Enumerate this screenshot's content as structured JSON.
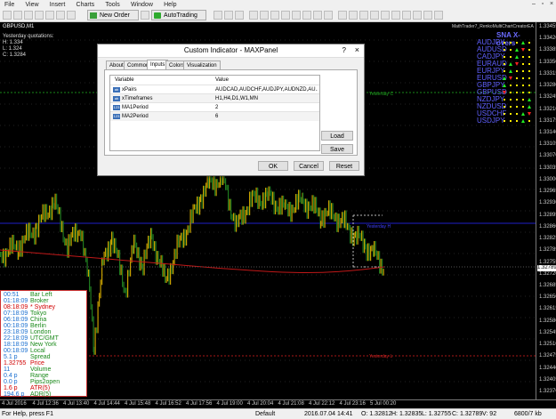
{
  "menu": [
    "File",
    "View",
    "Insert",
    "Charts",
    "Tools",
    "Window",
    "Help"
  ],
  "window_controls": [
    "–",
    "▫",
    "×"
  ],
  "toolbar": {
    "new_order": "New Order",
    "autotrading": "AutoTrading"
  },
  "chart": {
    "tab_title": "GBPUSD,M1",
    "info_lines": [
      "Yesterday quotations:",
      "H: 1.334",
      "L: 1.324",
      "C: 1.3284"
    ],
    "price_labels": [
      "1.33455",
      "1.33420",
      "1.33385",
      "1.33350",
      "1.33315",
      "1.33280",
      "1.33245",
      "1.33210",
      "1.33175",
      "1.33140",
      "1.33105",
      "1.33070",
      "1.33035",
      "1.33000",
      "1.32965",
      "1.32930",
      "1.32895",
      "1.32860",
      "1.32825",
      "1.32789",
      "1.32755",
      "1.32720",
      "1.32685",
      "1.32650",
      "1.32615",
      "1.32580",
      "1.32545",
      "1.32510",
      "1.32475",
      "1.32440",
      "1.32405",
      "1.32370"
    ],
    "time_labels": [
      "4 Jul 2016",
      "4 Jul 12:36",
      "4 Jul 13:40",
      "4 Jul 14:44",
      "4 Jul 15:48",
      "4 Jul 16:52",
      "4 Jul 17:56",
      "4 Jul 19:00",
      "4 Jul 20:04",
      "4 Jul 21:08",
      "4 Jul 22:12",
      "4 Jul 23:16",
      "5 Jul 00:20"
    ],
    "line_labels": {
      "green": "Yesterday C",
      "red": "Yesterday L",
      "blue": "Yesterday H"
    },
    "current_price": "1.32789",
    "header_right": "MathTrader7_RenkoMultiChartCreatorEA"
  },
  "sx_panel": {
    "title": "SNA  X-overs",
    "pairs": [
      "AUDJPY",
      "AUDUSD",
      "CADJPY",
      "EURAUD",
      "EURJPY",
      "EURUSD",
      "GBPJPY",
      "GBPUSD",
      "NZDJPY",
      "NZDUSD",
      "USDCHF",
      "USDJPY"
    ]
  },
  "session_panel": {
    "rows": [
      {
        "value": "00:51",
        "label": "Bar Left",
        "color": "#1a6fd0"
      },
      {
        "value": "01:18:09",
        "label": "Broker",
        "color": "#1a6fd0"
      },
      {
        "value": "08:18:09",
        "label": "* Sydney",
        "color": "#d00000"
      },
      {
        "value": "07:18:09",
        "label": "Tokyo",
        "color": "#1a6fd0"
      },
      {
        "value": "06:18:09",
        "label": "China",
        "color": "#1a6fd0"
      },
      {
        "value": "00:18:09",
        "label": "Berlin",
        "color": "#1a6fd0"
      },
      {
        "value": "23:18:09",
        "label": "London",
        "color": "#1a6fd0"
      },
      {
        "value": "22:18:09",
        "label": "UTC/GMT",
        "color": "#1a6fd0"
      },
      {
        "value": "18:18:09",
        "label": "New York",
        "color": "#1a6fd0"
      },
      {
        "value": "00:18:09",
        "label": "Local",
        "color": "#1a6fd0"
      },
      {
        "value": "5.1 p",
        "label": "Spread",
        "color": "#1a6fd0"
      },
      {
        "value": "1.32755",
        "label": "Price",
        "color": "#d00000"
      },
      {
        "value": "11",
        "label": "Volume",
        "color": "#1a6fd0"
      },
      {
        "value": "0.4 p",
        "label": "Range",
        "color": "#1a6fd0"
      },
      {
        "value": "0.0 p",
        "label": "Pips2open",
        "color": "#1a6fd0"
      },
      {
        "value": "1.6 p",
        "label": "ATR(5)",
        "color": "#d00000"
      },
      {
        "value": "194.6 p",
        "label": "ADR(5)",
        "color": "#1a6fd0"
      }
    ]
  },
  "dialog": {
    "title": "Custom Indicator - MAXPanel",
    "help": "?",
    "close": "×",
    "tabs": [
      "About",
      "Common",
      "Inputs",
      "Colors",
      "Visualization"
    ],
    "active_tab": "Inputs",
    "columns": [
      "Variable",
      "Value"
    ],
    "params": [
      {
        "icon": "ab",
        "name": "xPairs",
        "value": "AUDCAD,AUDCHF,AUDJPY,AUDNZD,AU..."
      },
      {
        "icon": "ab",
        "name": "xTimeframes",
        "value": "H1,H4,D1,W1,MN"
      },
      {
        "icon": "123",
        "name": "MA1Period",
        "value": "2"
      },
      {
        "icon": "123",
        "name": "MA2Period",
        "value": "6"
      }
    ],
    "load": "Load",
    "save": "Save",
    "ok": "OK",
    "cancel": "Cancel",
    "reset": "Reset"
  },
  "status": {
    "help": "For Help, press F1",
    "profile": "Default",
    "datetime": "2016.07.04 14:41",
    "open": "O: 1.32812",
    "high": "H: 1.32835",
    "low": "L: 1.32755",
    "close": "C: 1.32789",
    "volume": "V: 92",
    "traffic": "6800/7 kb"
  },
  "colors": {
    "candle_up": "#c8a000",
    "candle_down": "#1f7a1f",
    "ma_line": "#c01818",
    "blue_line": "#2020c8",
    "green_line": "#188818",
    "red_line": "#a81818"
  }
}
